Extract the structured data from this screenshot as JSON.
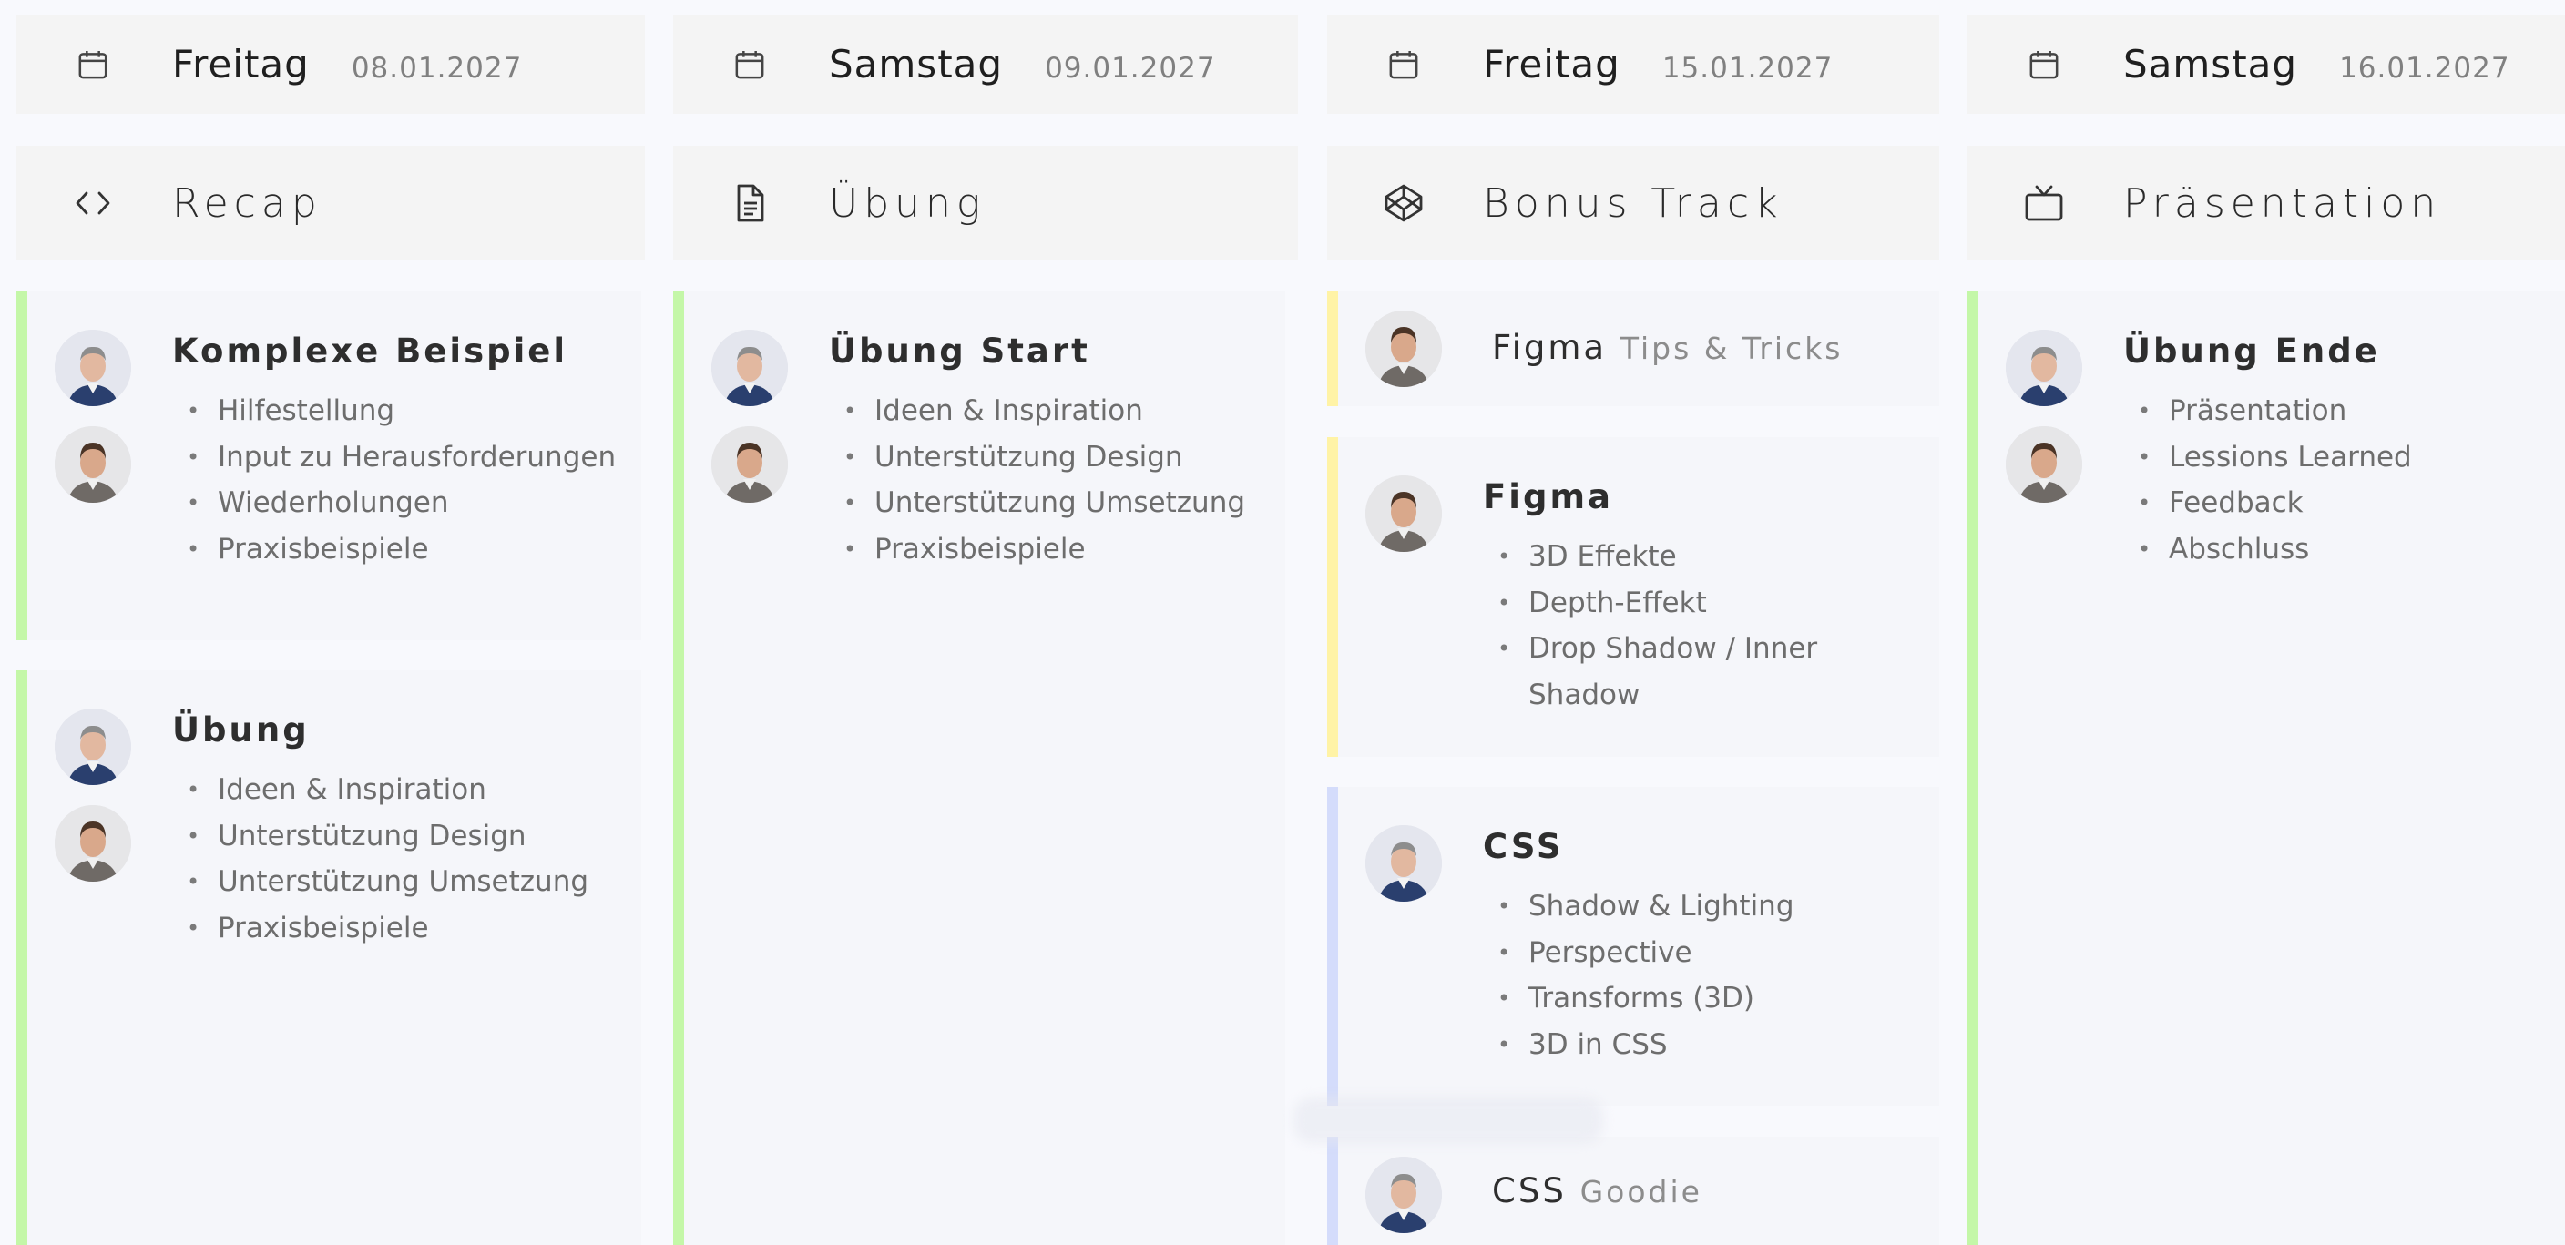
{
  "colors": {
    "page_bg": "#f8f9fd",
    "header_bg": "#f4f4f4",
    "card_bg": "#f5f6fa",
    "accent_green": "#c4f7a8",
    "accent_yellow": "#fff3a6",
    "accent_blue": "#d4dcfb"
  },
  "columns": [
    {
      "day": "Freitag",
      "date": "08.01.2027",
      "date_icon": "calendar-icon",
      "track": "Recap",
      "track_icon": "code-icon",
      "cards": [
        {
          "title": "Komplexe Beispiel",
          "subtitle": "",
          "accent": "green",
          "avatars": [
            "avatar-presenter-1",
            "avatar-presenter-2"
          ],
          "items": [
            "Hilfestellung",
            "Input zu Herausforderungen",
            "Wiederholungen",
            "Praxisbeispiele"
          ]
        },
        {
          "title": "Übung",
          "subtitle": "",
          "accent": "green",
          "avatars": [
            "avatar-presenter-1",
            "avatar-presenter-2"
          ],
          "items": [
            "Ideen & Inspiration",
            "Unterstützung Design",
            "Unterstützung Umsetzung",
            "Praxisbeispiele"
          ]
        }
      ]
    },
    {
      "day": "Samstag",
      "date": "09.01.2027",
      "date_icon": "calendar-icon",
      "track": "Übung",
      "track_icon": "document-icon",
      "cards": [
        {
          "title": "Übung Start",
          "subtitle": "",
          "accent": "green",
          "avatars": [
            "avatar-presenter-1",
            "avatar-presenter-2"
          ],
          "items": [
            "Ideen & Inspiration",
            "Unterstützung Design",
            "Unterstützung Umsetzung",
            "Praxisbeispiele"
          ]
        }
      ]
    },
    {
      "day": "Freitag",
      "date": "15.01.2027",
      "date_icon": "calendar-icon",
      "track": "Bonus Track",
      "track_icon": "codepen-icon",
      "cards": [
        {
          "title": "Figma",
          "subtitle": "Tips & Tricks",
          "accent": "yellow",
          "avatars": [
            "avatar-presenter-2"
          ],
          "items": []
        },
        {
          "title": "Figma",
          "subtitle": "",
          "accent": "yellow",
          "avatars": [
            "avatar-presenter-2"
          ],
          "items": [
            "3D Effekte",
            "Depth-Effekt",
            "Drop Shadow / Inner Shadow"
          ]
        },
        {
          "title": "CSS",
          "subtitle": "",
          "accent": "blue",
          "avatars": [
            "avatar-presenter-1"
          ],
          "items": [
            "Shadow & Lighting",
            "Perspective",
            "Transforms (3D)",
            "3D in CSS"
          ]
        },
        {
          "title": "CSS",
          "subtitle": "Goodie",
          "accent": "blue",
          "avatars": [
            "avatar-presenter-1"
          ],
          "items": []
        }
      ]
    },
    {
      "day": "Samstag",
      "date": "16.01.2027",
      "date_icon": "calendar-icon",
      "track": "Präsentation",
      "track_icon": "tv-icon",
      "cards": [
        {
          "title": "Übung Ende",
          "subtitle": "",
          "accent": "green",
          "avatars": [
            "avatar-presenter-1",
            "avatar-presenter-2"
          ],
          "items": [
            "Präsentation",
            "Lessions Learned",
            "Feedback",
            "Abschluss"
          ]
        }
      ]
    }
  ]
}
